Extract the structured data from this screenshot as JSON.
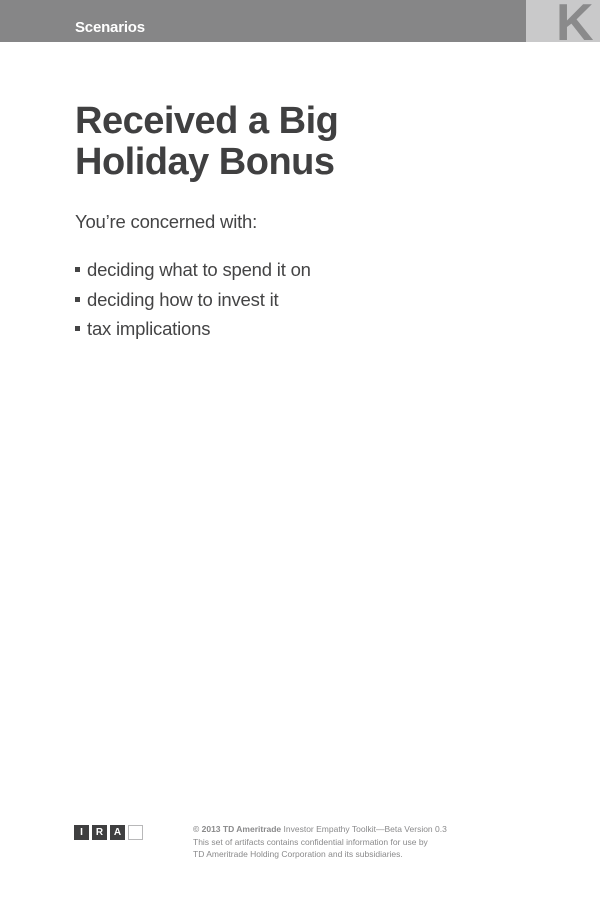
{
  "header": {
    "section_label": "Scenarios",
    "tab_letter": "K"
  },
  "content": {
    "title_line1": "Received a Big",
    "title_line2": "Holiday Bonus",
    "intro": "You’re concerned with:",
    "concerns": [
      "deciding what to spend it on",
      "deciding how to invest it",
      "tax implications"
    ]
  },
  "footer": {
    "logo_letters": [
      "I",
      "R",
      "A"
    ],
    "copyright_strong": "© 2013 TD Ameritrade",
    "copyright_rest": " Investor Empathy Toolkit—Beta Version 0.3",
    "line2": "This set of artifacts contains confidential information for use by",
    "line3": "TD Ameritrade Holding Corporation and its subsidiaries."
  }
}
